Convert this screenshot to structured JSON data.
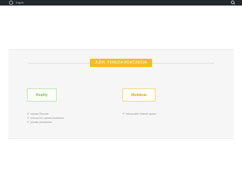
{
  "adminbar": {
    "login_label": "Log in",
    "logo_icon": "wordpress-icon",
    "search_icon": "search-icon",
    "background": "#23282d"
  },
  "section": {
    "title": "JUDR. TERÉZIA BORČINOVÁ",
    "accent_color": "#f3bd24",
    "services": [
      {
        "label": "Reality",
        "color": "#7cc15b",
        "features": [
          {
            "icon": "check-icon",
            "text": "nepriaz Čtenosti"
          },
          {
            "icon": "check-icon",
            "text": "ohnova frov sprosti ohodnenia"
          },
          {
            "icon": "check-icon",
            "text": "priznav povodovnie"
          }
        ]
      },
      {
        "label": "Mediácia",
        "color": "#dca11a",
        "features": [
          {
            "icon": "check-icon",
            "text": "mimosudne riešenie sporov"
          }
        ]
      }
    ]
  }
}
